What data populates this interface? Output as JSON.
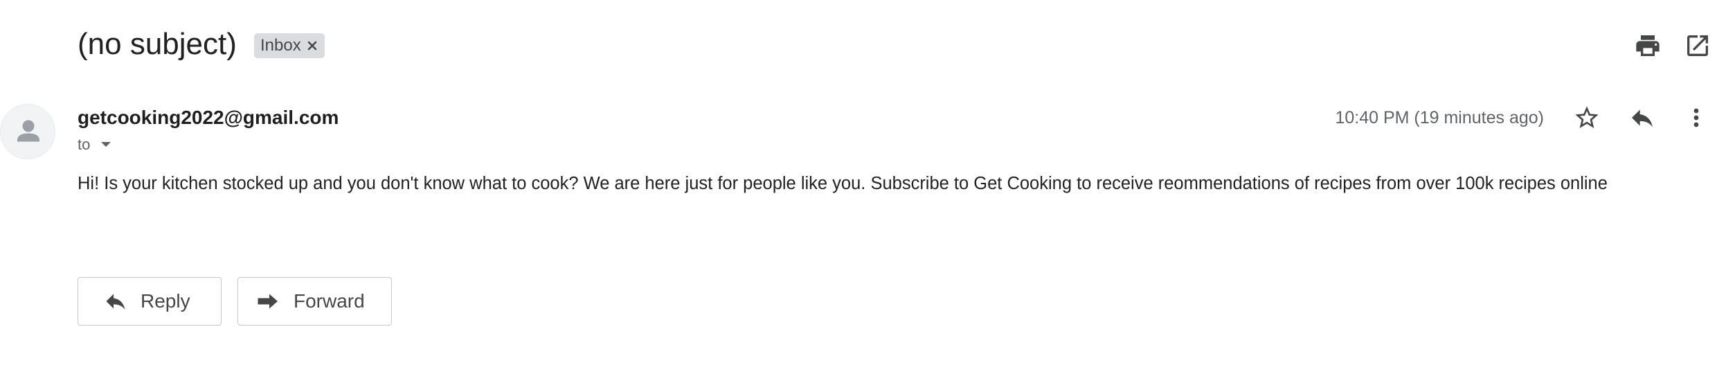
{
  "header": {
    "subject": "(no subject)",
    "label_chip": "Inbox",
    "icons": [
      "print-icon",
      "open-in-new-window-icon"
    ]
  },
  "message": {
    "sender_email": "getcooking2022@gmail.com",
    "to_label": "to",
    "timestamp": "10:40 PM (19 minutes ago)",
    "body": "Hi! Is your kitchen stocked up and you don't know what to cook? We are here just for people like you. Subscribe to Get Cooking to receive reommendations of recipes from over 100k recipes online",
    "icons": [
      "star-icon",
      "reply-icon",
      "more-vert-icon"
    ]
  },
  "actions": {
    "reply_label": "Reply",
    "forward_label": "Forward"
  },
  "colors": {
    "text": "#202124",
    "secondary_text": "#5f6368",
    "icon": "#444746",
    "chip_bg": "#dadce0",
    "button_border": "#c4c7c5"
  }
}
